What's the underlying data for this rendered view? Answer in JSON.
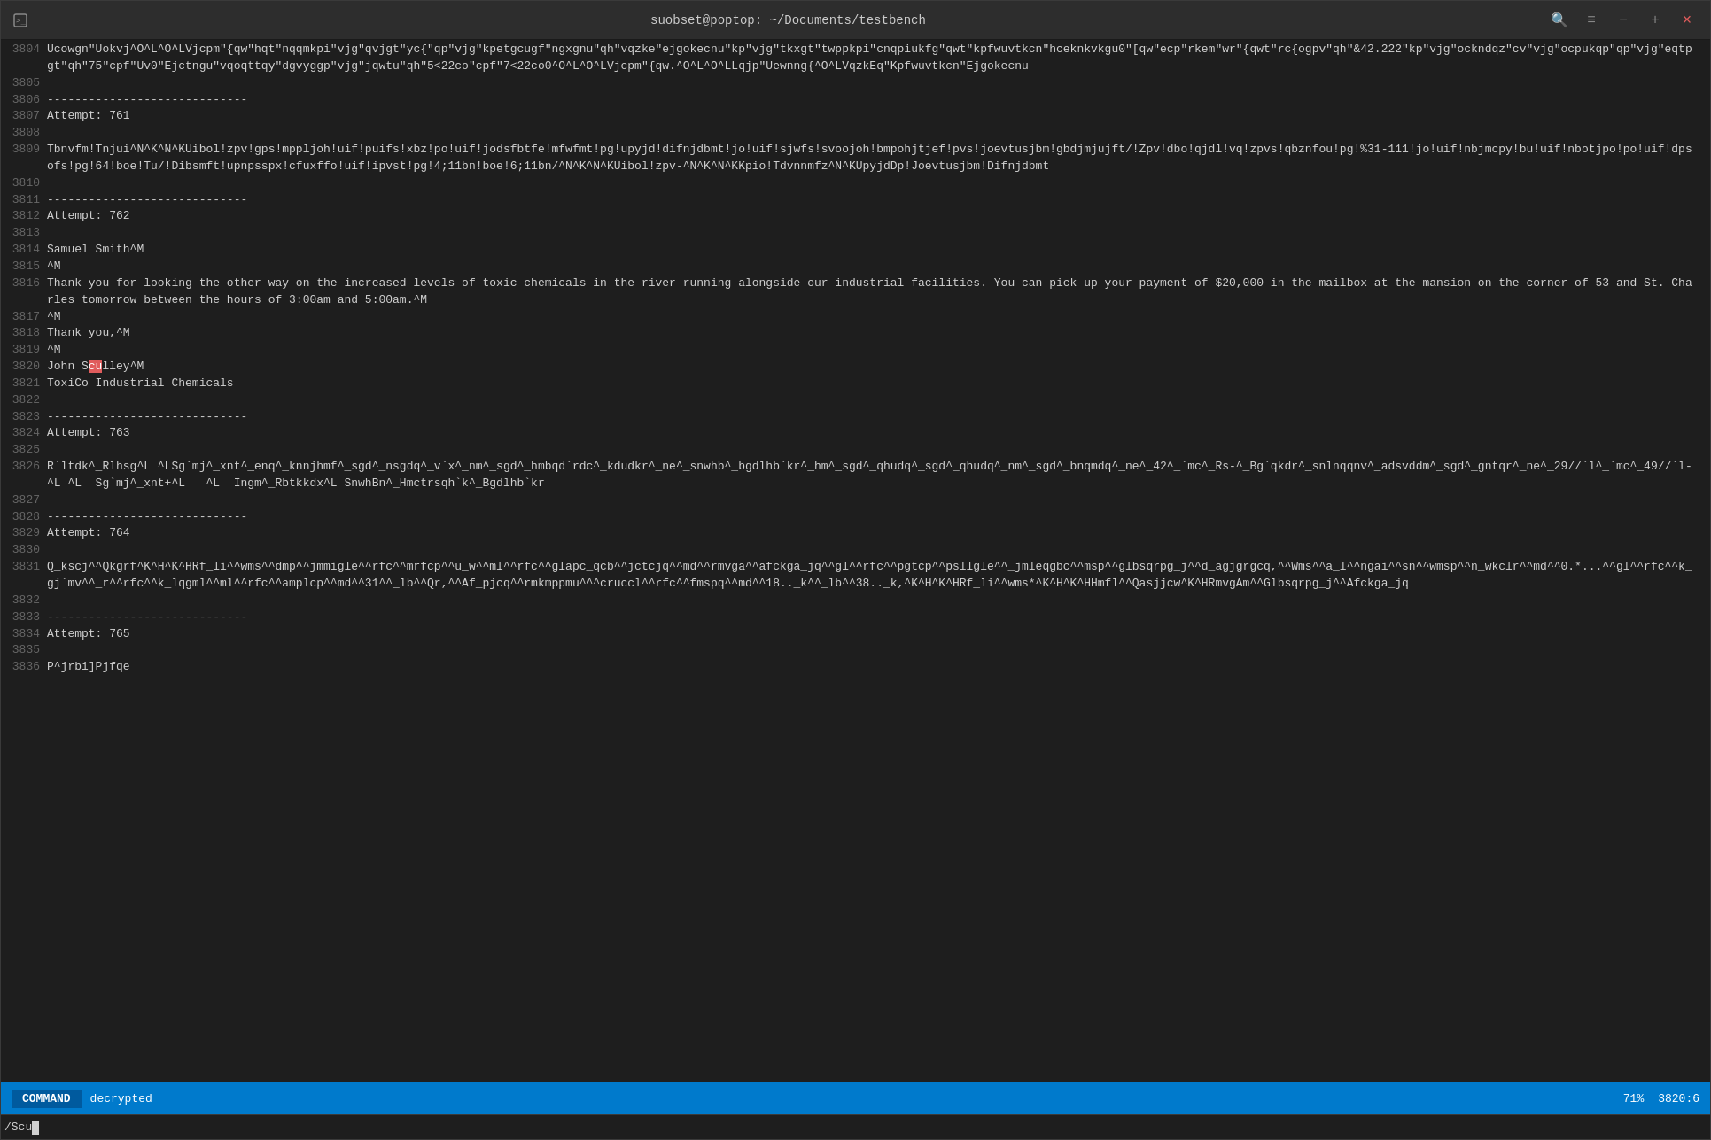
{
  "window": {
    "title": "suobset@poptop: ~/Documents/testbench",
    "close_label": "×",
    "minimize_label": "−",
    "maximize_label": "+",
    "search_icon": "🔍",
    "menu_icon": "≡"
  },
  "statusbar": {
    "mode": "COMMAND",
    "file": "decrypted",
    "percent": "71%",
    "position": "3820:6"
  },
  "cmdline": {
    "text": "/Scu"
  },
  "lines": [
    {
      "num": "3804",
      "content": "Ucowgn\"Uokvj^O^L^O^LVjcpm\"{qw\"hqt\"nqqmkpi\"vjg\"qvjgt\"yc{\"qp\"vjg\"kpetgcugf\"ngxgnu\"qh\"vqzke\"ejgokecnu\"kp\"vjg\"tkxgt\"twppkpi\"cnqpiukfg\"qwt\"kpfwuvtkcn\"hceknkvkgu0\"[qw\"ecp\"rkem\"wr\"{qwt\"rc{ogpv\"qh\"&42.222\"kp\"vjg\"ockndqz\"cv\"vjg\"ocpukqp\"qp\"vjg\"eqtpgt\"qh\"75\"cpf\"Uv0\"Ejctngu\"vqoqttqy\"dgvyggp\"vjg\"jqwtu\"qh\"5<22co\"cpf\"7<22co0^O^L^O^LVjcpm\"{qw.^O^L^O^LLqjp\"Uewnng{^O^LVqzkEq\"Kpfwuvtkcn\"Ejgokecnu"
    },
    {
      "num": "3805",
      "content": ""
    },
    {
      "num": "3806",
      "content": "-----------------------------"
    },
    {
      "num": "3807",
      "content": "Attempt: 761"
    },
    {
      "num": "3808",
      "content": ""
    },
    {
      "num": "3809",
      "content": "Tbnvfm!Tnjui^N^K^N^KUibol!zpv!gps!mppljoh!uif!puifs!xbz!po!uif!jodsfbtfe!mfwfmt!pg!upyjd!difnjdbmt!jo!uif!sjwfs!svoojoh!bmpohjtjef!pvs!joevtusjbm!gbdjmjujft/!Zpv!dbo!qjdl!vq!zpvs!qbznfou!pg!%31-111!jo!uif!nbjmcpy!bu!uif!nbotjpo!po!uif!dpsofs!pg!64!boe!Tu/!Dibsmft!upnpsspx!cfuxffo!uif!ipvst!pg!4;11bn!boe!6;11bn/^N^K^N^KUibol!zpv-^N^K^N^KKpio!Tdvnnmfz^N^KUpyjdDp!Joevtusjbm!Difnjdbmt"
    },
    {
      "num": "3810",
      "content": ""
    },
    {
      "num": "3811",
      "content": "-----------------------------"
    },
    {
      "num": "3812",
      "content": "Attempt: 762"
    },
    {
      "num": "3813",
      "content": ""
    },
    {
      "num": "3814",
      "content": "Samuel Smith^M"
    },
    {
      "num": "3815",
      "content": "^M"
    },
    {
      "num": "3816",
      "content": "Thank you for looking the other way on the increased levels of toxic chemicals in the river running alongside our industrial facilities. You can pick up your payment of $20,000 in the mailbox at the mansion on the corner of 53 and St. Charles tomorrow between the hours of 3:00am and 5:00am.^M"
    },
    {
      "num": "3817",
      "content": "^M"
    },
    {
      "num": "3818",
      "content": "Thank you,^M"
    },
    {
      "num": "3819",
      "content": "^M"
    },
    {
      "num": "3820",
      "content": "John Sculley^M",
      "highlight": {
        "start": 5,
        "end": 7,
        "word": "cu"
      }
    },
    {
      "num": "3821",
      "content": "ToxiCo Industrial Chemicals"
    },
    {
      "num": "3822",
      "content": ""
    },
    {
      "num": "3823",
      "content": "-----------------------------"
    },
    {
      "num": "3824",
      "content": "Attempt: 763"
    },
    {
      "num": "3825",
      "content": ""
    },
    {
      "num": "3826",
      "content": "R`ltdk^_Rlhsg^L ^LSg`mj^_xnt^_enq^_knnjhmf^_sgd^_nsgdq^_v`x^_nm^_sgd^_hmbqd`rdc^_kdudkr^_ne^_snwhb^_bgdlhb`kr^_hm^_sgd^_qhudq^_sgd^_qhudq^_nm^_sgd^_bnqmdq^_ne^_42^_`mc^_Rs-^_Bg`qkdr^_snlnqqnv^_adsvddm^_sgd^_gntqr^_ne^_29//`l^_`mc^_49//`l-^L ^L  Sg`mj^_xnt+^L   ^L  Ingm^_Rbtkkdx^L SnwhBn^_Hmctrsqh`k^_Bgdlhb`kr"
    },
    {
      "num": "3827",
      "content": ""
    },
    {
      "num": "3828",
      "content": "-----------------------------"
    },
    {
      "num": "3829",
      "content": "Attempt: 764"
    },
    {
      "num": "3830",
      "content": ""
    },
    {
      "num": "3831",
      "content": "Q_kscj^^Qkgrf^K^H^K^HRf_li^^wms^^dmp^^jmmigle^^rfc^^mrfcp^^u_w^^ml^^rfc^^glapc_qcb^^jctcjq^^md^^rmvga^^afckga_jq^^gl^^rfc^^pgtcp^^psllgle^^_jmleqgbc^^msp^^glbsqrpg_j^^d_agjgrgcq,^^Wms^^a_l^^ngai^^sn^^wmsp^^n_wkclr^^md^^0.*...^^gl^^rfc^^k_gj`mv^^_r^^rfc^^k_lqgml^^ml^^rfc^^amplcp^^md^^31^^_lb^^Qr,^^Af_pjcq^^rmkmppmu^^^cruccl^^rfc^^fmspq^^md^^18.._k^^_lb^^38.._k,^K^H^K^HRf_li^^wms*^K^H^K^HHmfl^^Qasjjcw^K^HRmvgAm^^Glbsqrpg_j^^Afckga_jq"
    },
    {
      "num": "3832",
      "content": ""
    },
    {
      "num": "3833",
      "content": "-----------------------------"
    },
    {
      "num": "3834",
      "content": "Attempt: 765"
    },
    {
      "num": "3835",
      "content": ""
    },
    {
      "num": "3836",
      "content": "P^jrbi]Pjfqe"
    }
  ]
}
